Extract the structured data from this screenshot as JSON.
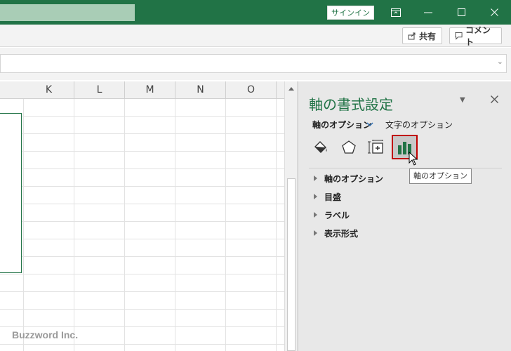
{
  "titlebar": {
    "signin_label": "サインイン",
    "color": "#217346"
  },
  "ribbon": {
    "share_label": "共有",
    "comment_label": "コメント"
  },
  "columns": [
    "K",
    "L",
    "M",
    "N",
    "O"
  ],
  "pane": {
    "title": "軸の書式設定",
    "tab_axis_options": "軸のオプション",
    "tab_text_options": "文字のオプション",
    "icons": [
      "fill-line-icon",
      "effects-icon",
      "size-properties-icon",
      "axis-options-icon"
    ],
    "selected_icon": "axis-options-icon",
    "tooltip": "軸のオプション",
    "sections": [
      "軸のオプション",
      "目盛",
      "ラベル",
      "表示形式"
    ]
  },
  "watermark": "Buzzword Inc."
}
